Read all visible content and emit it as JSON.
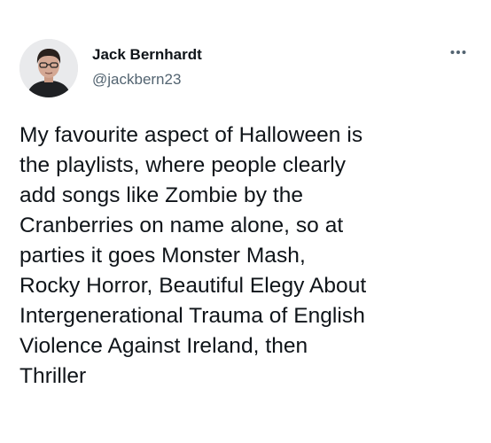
{
  "tweet": {
    "author": {
      "display_name": "Jack Bernhardt",
      "handle": "@jackbern23",
      "avatar_icon": "profile-photo"
    },
    "more_icon": "more-options-icon",
    "text": "My favourite aspect of Halloween is\nthe playlists, where people clearly\nadd songs like Zombie by the\nCranberries on name alone, so at\nparties it goes Monster Mash,\nRocky Horror, Beautiful Elegy About\nIntergenerational Trauma of English\nViolence Against Ireland, then\nThriller"
  },
  "colors": {
    "text_primary": "#0f1419",
    "text_secondary": "#536471",
    "background": "#ffffff"
  }
}
